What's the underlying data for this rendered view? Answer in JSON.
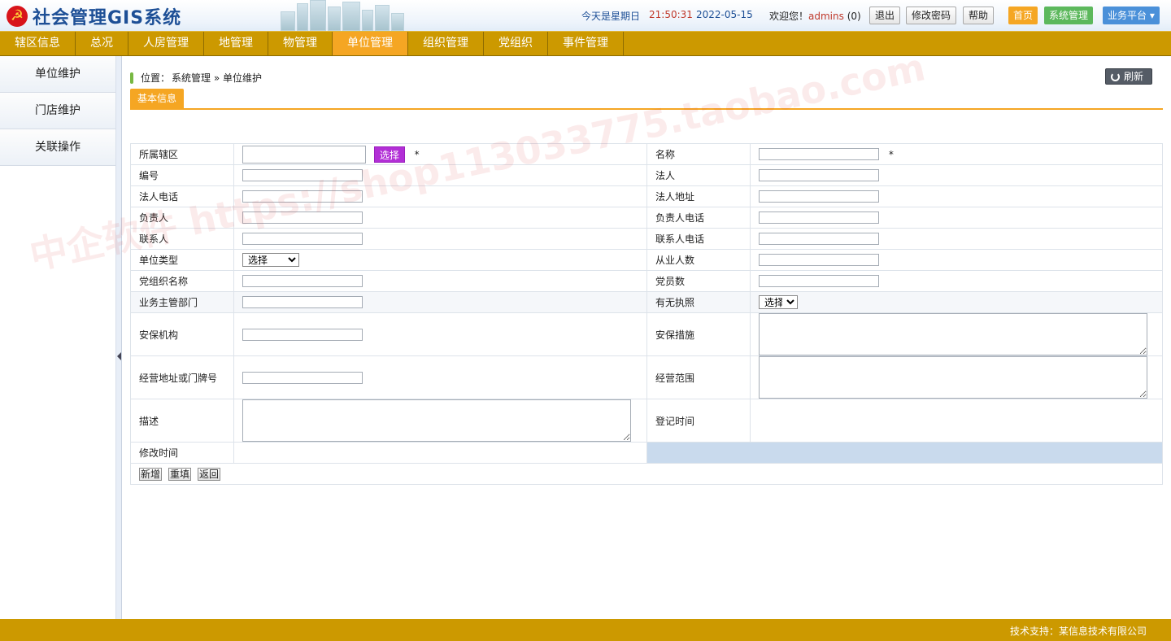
{
  "app": {
    "logo_glyph": "☭",
    "title": "社会管理GIS系统"
  },
  "header": {
    "date_label": "今天是星期日",
    "time": "21:50:31",
    "date": "2022-05-15",
    "welcome": "欢迎您！",
    "username": "admins",
    "message_count": "(0)",
    "logout": "退出",
    "change_password": "修改密码",
    "help": "帮助",
    "home": "首页",
    "system_management": "系统管理",
    "business_platform": "业务平台 ▾",
    "colors": {
      "home": "#f5a623",
      "system": "#5cb85c",
      "platform": "#4a90d9"
    }
  },
  "menu": {
    "items": [
      "辖区信息",
      "总况",
      "人房管理",
      "地管理",
      "物管理",
      "单位管理",
      "组织管理",
      "党组织",
      "事件管理"
    ],
    "active_index": 5
  },
  "sidebar": {
    "items": [
      "单位维护",
      "门店维护",
      "关联操作"
    ]
  },
  "breadcrumb": {
    "label": "位置：",
    "path": "系统管理 » 单位维护"
  },
  "refresh_label": "刷新",
  "tab_label": "基本信息",
  "form": {
    "select_button": "选择",
    "required_mark": "*",
    "select_placeholder": "选择",
    "labels": {
      "district": "所属辖区",
      "name": "名称",
      "code": "编号",
      "legal_person": "法人",
      "legal_phone": "法人电话",
      "legal_address": "法人地址",
      "principal": "负责人",
      "principal_phone": "负责人电话",
      "contact": "联系人",
      "contact_phone": "联系人电话",
      "unit_type": "单位类型",
      "employees": "从业人数",
      "party_org": "党组织名称",
      "party_members": "党员数",
      "supervisor": "业务主管部门",
      "license": "有无执照",
      "security_org": "安保机构",
      "security_measures": "安保措施",
      "address": "经营地址或门牌号",
      "scope": "经营范围",
      "description": "描述",
      "register_time": "登记时间",
      "modify_time": "修改时间"
    },
    "actions": {
      "add": "新增",
      "reset": "重填",
      "back": "返回"
    }
  },
  "footer": {
    "support": "技术支持：某信息技术有限公司"
  },
  "watermark": "中企软件 https://shop113033775.taobao.com"
}
